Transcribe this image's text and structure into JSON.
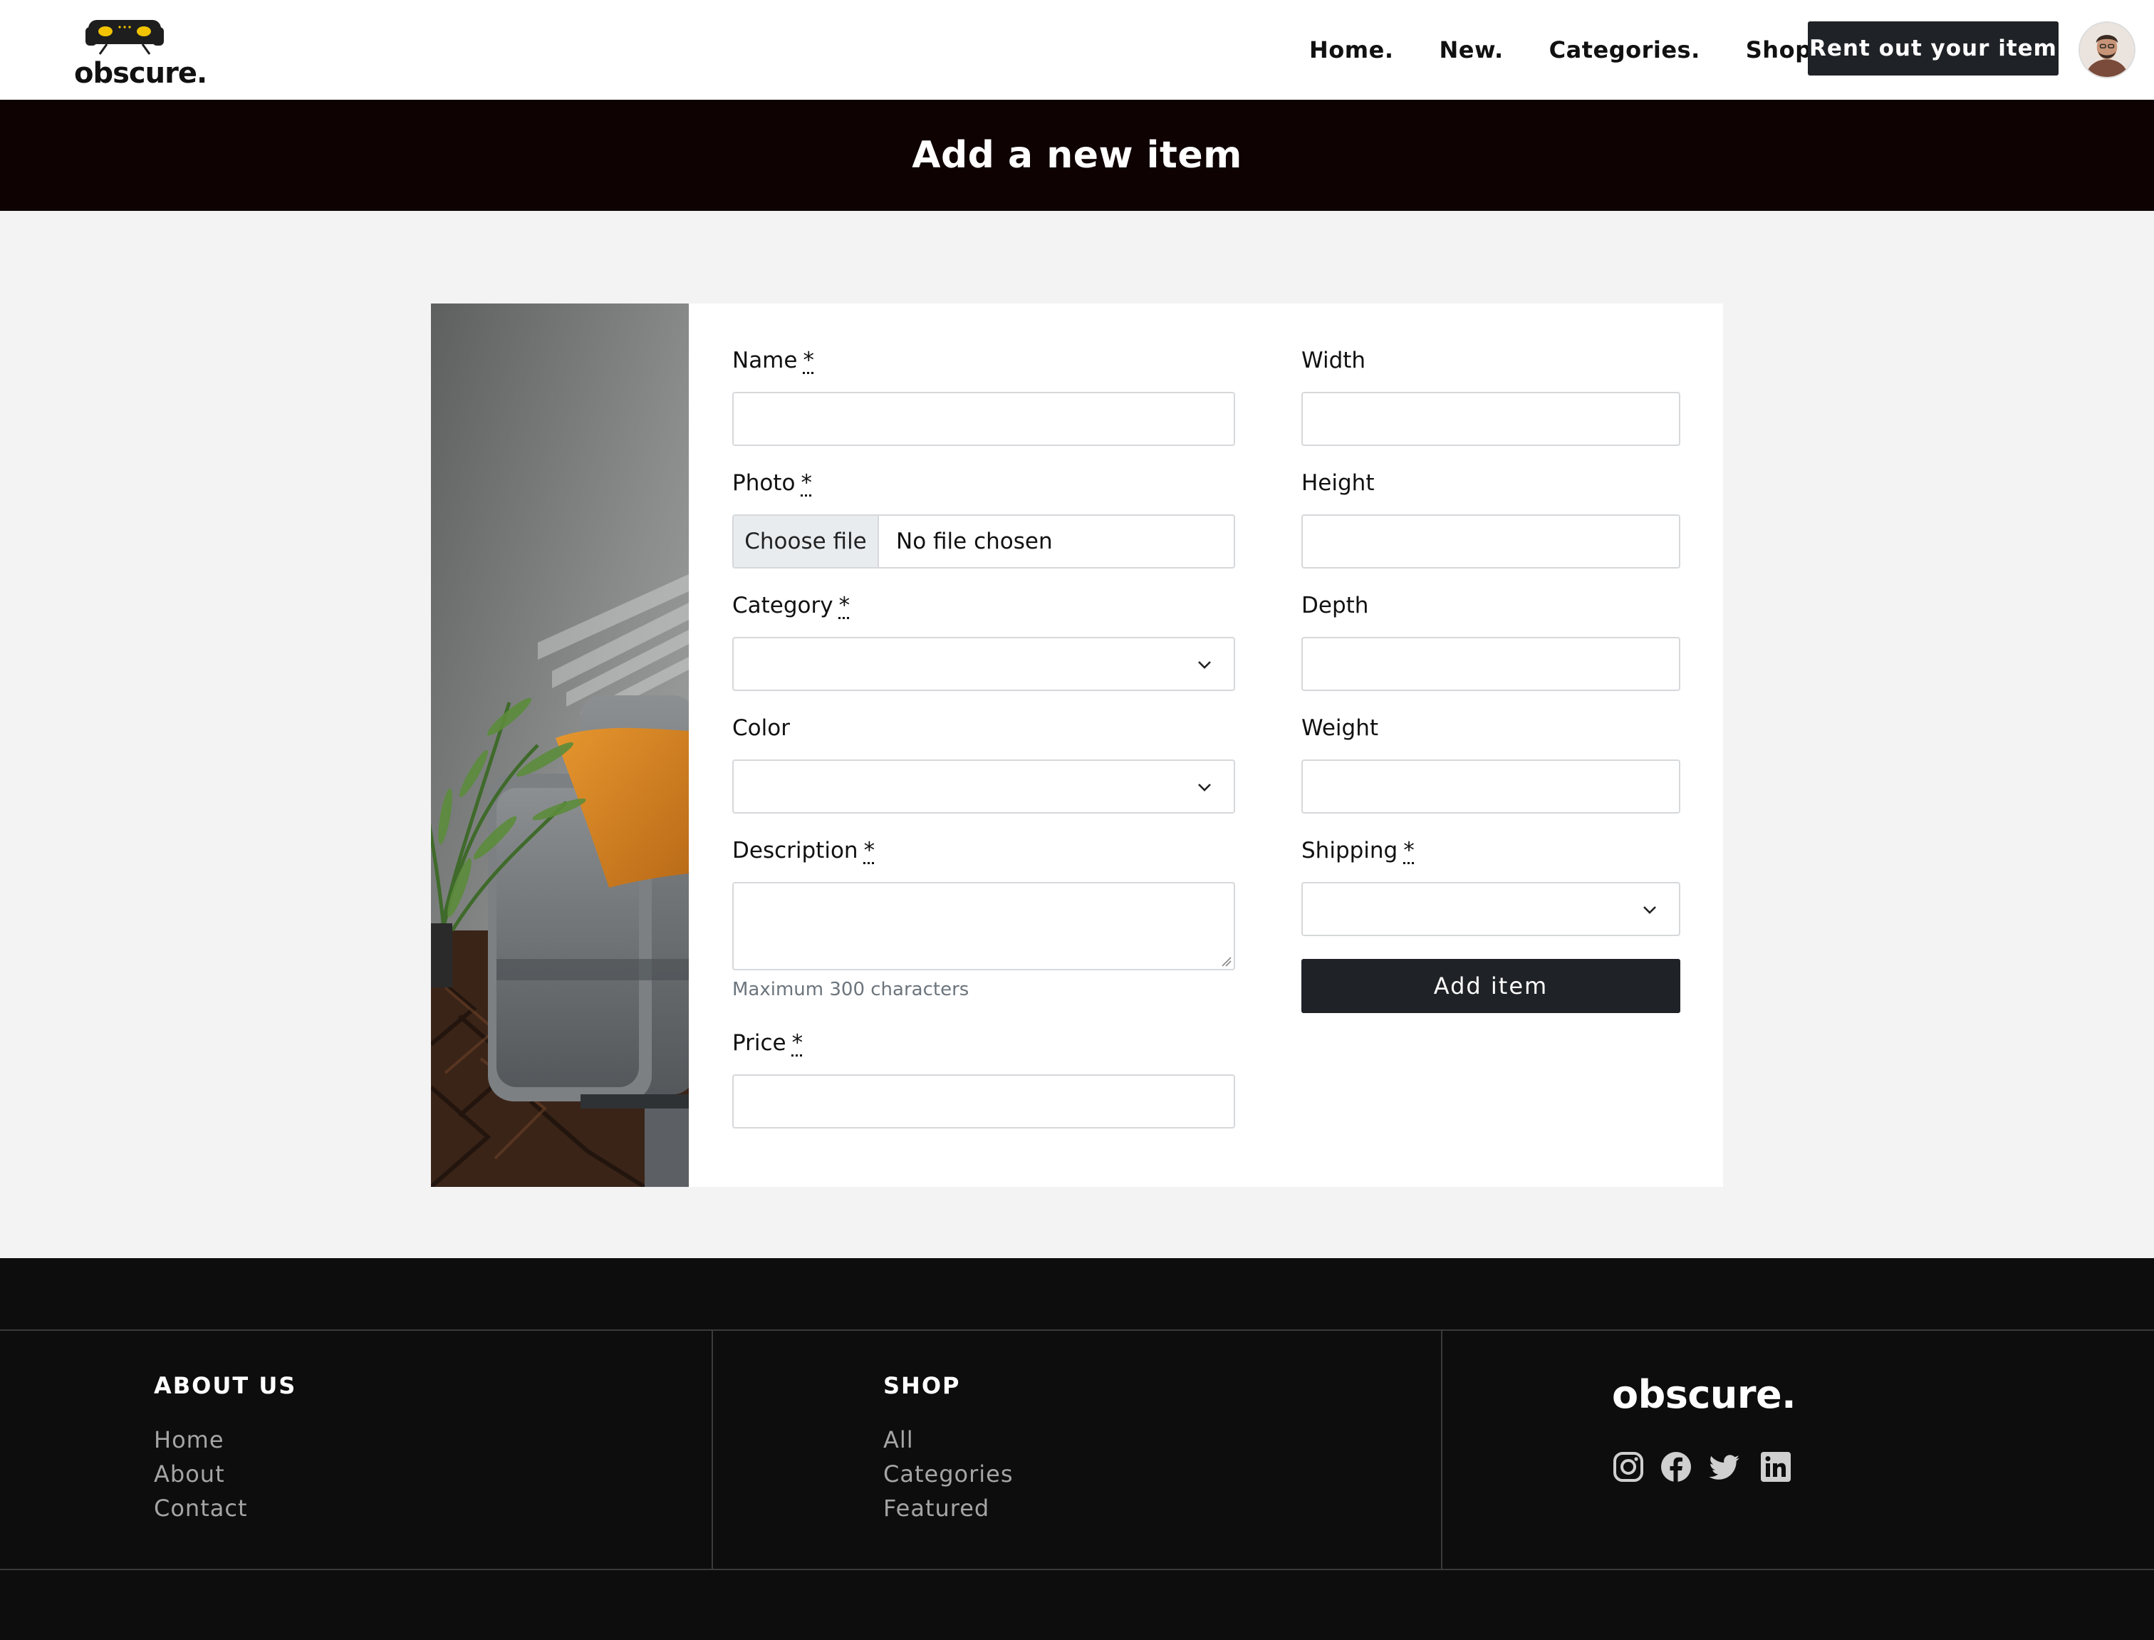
{
  "brand": {
    "name": "obscure.",
    "icon": "sofa-icon",
    "accent": "#f2c400"
  },
  "nav": {
    "links": [
      "Home.",
      "New.",
      "Categories.",
      "Shop."
    ],
    "cta": "Rent out your item",
    "avatar": "user-avatar"
  },
  "banner": {
    "title": "Add a new item"
  },
  "form": {
    "required_marker": "*",
    "name_label": "Name",
    "photo_label": "Photo",
    "photo_button": "Choose file",
    "photo_status": "No file chosen",
    "category_label": "Category",
    "color_label": "Color",
    "description_label": "Description",
    "description_help": "Maximum 300 characters",
    "price_label": "Price",
    "width_label": "Width",
    "height_label": "Height",
    "depth_label": "Depth",
    "weight_label": "Weight",
    "shipping_label": "Shipping",
    "submit": "Add item"
  },
  "footer": {
    "about_heading": "ABOUT US",
    "about_links": [
      "Home",
      "About",
      "Contact"
    ],
    "shop_heading": "SHOP",
    "shop_links": [
      "All",
      "Categories",
      "Featured"
    ],
    "brand": "obscure.",
    "social_icons": [
      "instagram-icon",
      "facebook-icon",
      "twitter-icon",
      "linkedin-icon"
    ]
  },
  "colors": {
    "banner_bg": "#0f0203",
    "button_bg": "#1f2226",
    "footer_bg": "#0d0d0d",
    "page_bg": "#f3f3f3"
  }
}
